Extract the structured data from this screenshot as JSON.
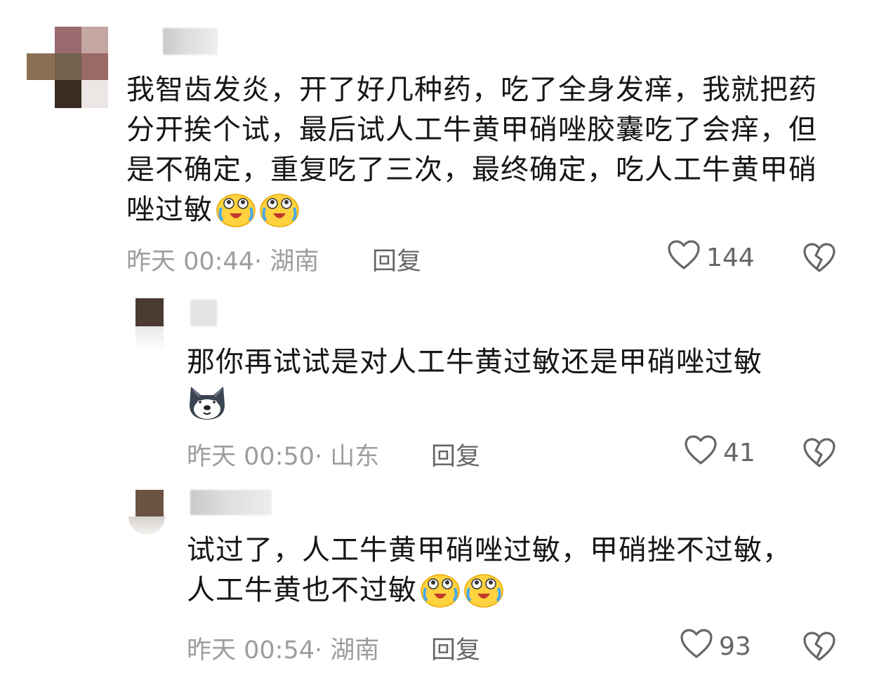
{
  "comments": [
    {
      "text": "我智齿发炎，开了好几种药，吃了全身发痒，我就把药分开挨个试，最后试人工牛黄甲硝唑胶囊吃了会痒，但是不确定，重复吃了三次，最终确定，吃人工牛黄甲硝唑过敏",
      "emojis": [
        "crying-laughing-emoji",
        "crying-laughing-emoji"
      ],
      "time": "昨天 00:44",
      "location": "湖南",
      "time_location": "昨天 00:44· 湖南",
      "reply_label": "回复",
      "likes": "144",
      "liked": false
    },
    {
      "text": "那你再试试是对人工牛黄过敏还是甲硝唑过敏",
      "emojis": [
        "husky-dog-emoji"
      ],
      "time": "昨天 00:50",
      "location": "山东",
      "time_location": "昨天 00:50· 山东",
      "reply_label": "回复",
      "likes": "41",
      "liked": false
    },
    {
      "text": "试过了，人工牛黄甲硝唑过敏，甲硝挫不过敏，人工牛黄也不过敏",
      "emojis": [
        "crying-laughing-emoji",
        "crying-laughing-emoji"
      ],
      "time": "昨天 00:54",
      "location": "湖南",
      "time_location": "昨天 00:54· 湖南",
      "reply_label": "回复",
      "likes": "93",
      "liked": false
    }
  ],
  "icons": {
    "like": "heart-outline-icon",
    "dislike": "broken-heart-icon"
  },
  "colors": {
    "text": "#161616",
    "meta": "#9d9d9d",
    "reply": "#666666",
    "icon": "#666666"
  }
}
